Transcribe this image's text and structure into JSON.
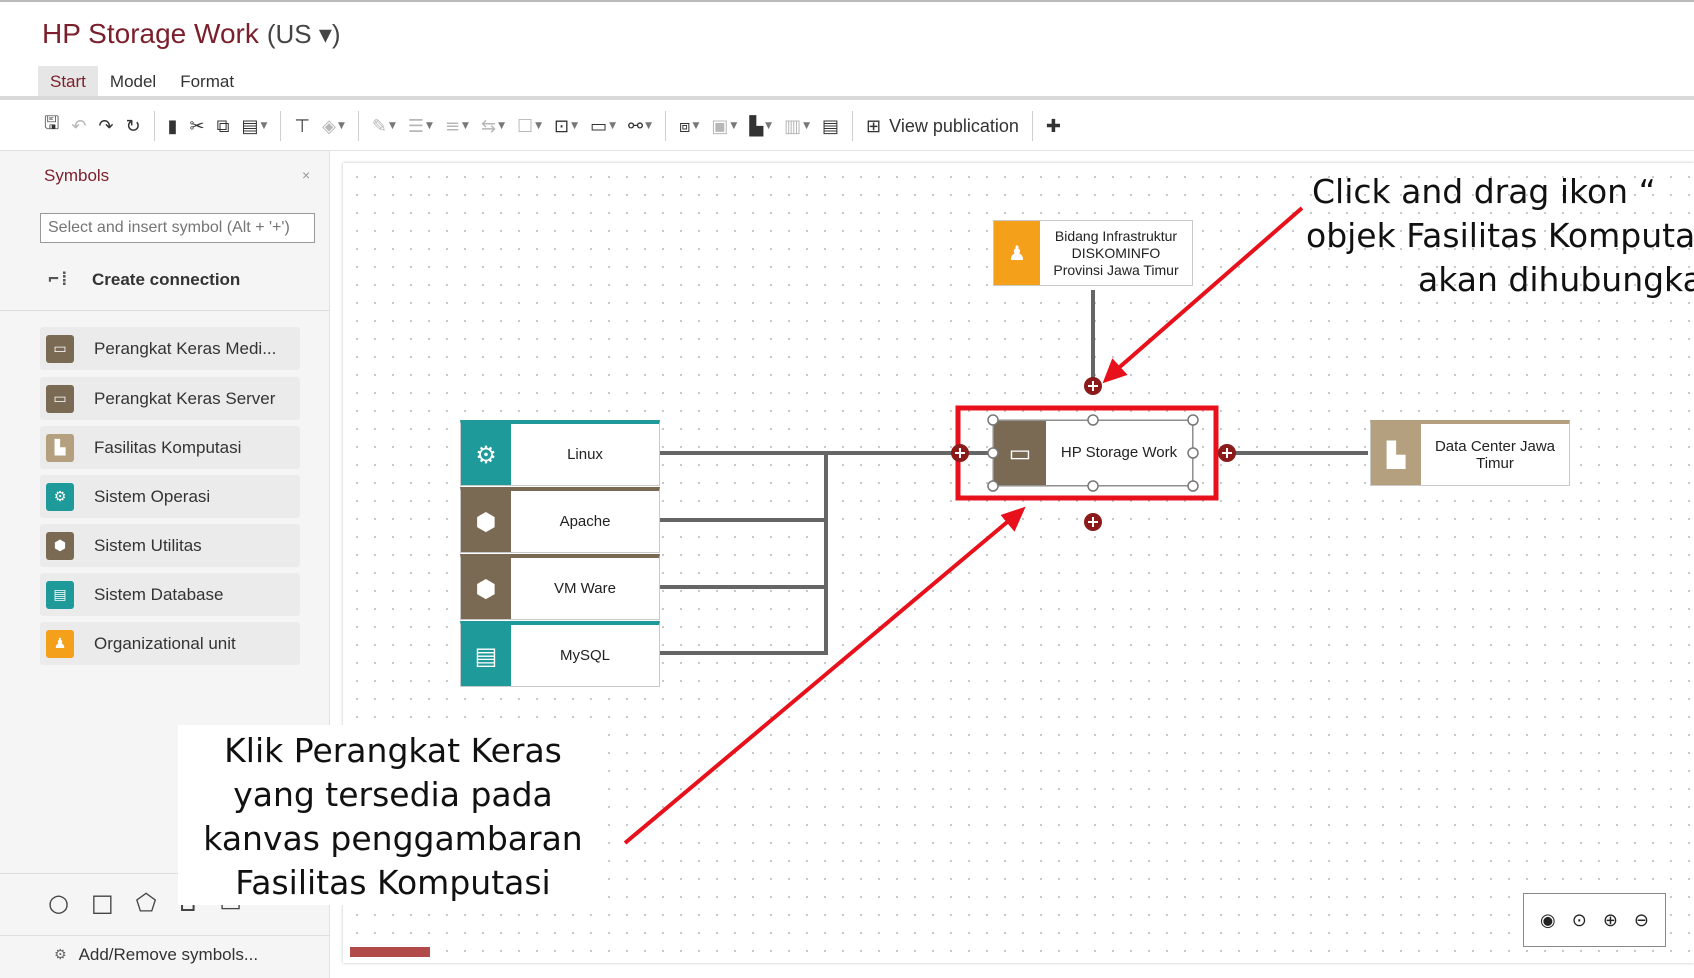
{
  "app": {
    "title": "HP Storage Work",
    "lang": "(US ▾)",
    "tabs": [
      "Start",
      "Model",
      "Format"
    ]
  },
  "toolbar": {
    "view_publication": "View publication"
  },
  "sidebar": {
    "header": "Symbols",
    "close": "×",
    "search_placeholder": "Select and insert symbol (Alt + '+')",
    "create_connection": "Create connection",
    "symbols": [
      {
        "label": "Perangkat Keras Medi...",
        "color": "#7a6a53",
        "icon": "monitor-icon"
      },
      {
        "label": "Perangkat Keras Server",
        "color": "#7a6a53",
        "icon": "monitor-icon"
      },
      {
        "label": "Fasilitas Komputasi",
        "color": "#b4a07e",
        "icon": "factory-icon"
      },
      {
        "label": "Sistem Operasi",
        "color": "#1f9a9a",
        "icon": "os-icon"
      },
      {
        "label": "Sistem Utilitas",
        "color": "#7a6a53",
        "icon": "cube-icon"
      },
      {
        "label": "Sistem Database",
        "color": "#1f9a9a",
        "icon": "database-window-icon"
      },
      {
        "label": "Organizational unit",
        "color": "#f5a01a",
        "icon": "org-unit-icon"
      }
    ],
    "add_remove": "Add/Remove symbols..."
  },
  "diagram": {
    "org_unit": "Bidang Infrastruktur\nDISKOMINFO\nProvinsi Jawa Timur",
    "software": [
      "Linux",
      "Apache",
      "VM Ware",
      "MySQL"
    ],
    "selected": "HP Storage Work",
    "data_center": "Data Center Jawa\nTimur"
  },
  "callouts": {
    "left": [
      "Klik Perangkat Keras",
      "yang tersedia pada",
      "kanvas penggambaran",
      "Fasilitas Komputasi"
    ],
    "right": [
      "Click and drag ikon “",
      "objek Fasilitas Komputa",
      "akan dihubungka"
    ]
  },
  "colors": {
    "brand": "#7a1f2b",
    "hardware": "#7a6a53",
    "facility": "#b4a07e",
    "teal": "#1f9a9a",
    "org": "#f5a01a",
    "highlight": "#e8101a"
  }
}
